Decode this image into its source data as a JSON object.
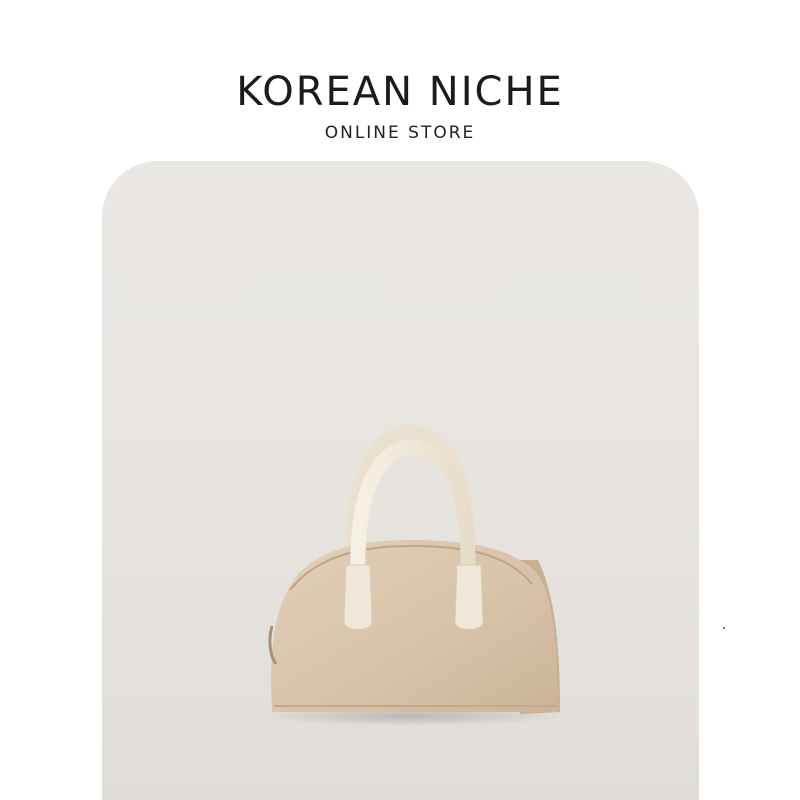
{
  "brand": {
    "title": "KOREAN NICHE",
    "subtitle": "ONLINE STORE"
  },
  "colors": {
    "panel_background": "#e7e4e0",
    "bag_body": "#d8c3ab",
    "bag_handles": "#f1eadc",
    "text": "#1b1b1b"
  },
  "product": {
    "image_subject": "beige canvas bowling handbag with cream leather handles"
  }
}
